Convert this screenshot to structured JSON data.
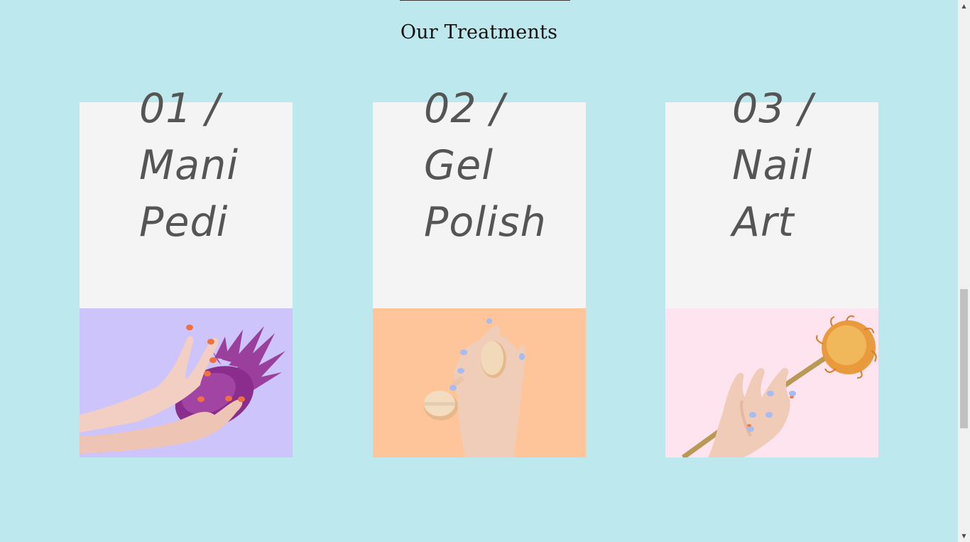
{
  "section": {
    "title": "Our Treatments"
  },
  "treatments": [
    {
      "number": "01 /",
      "line1": "Mani",
      "line2": "Pedi",
      "photo_bg": "#cdc4fb",
      "photo": "hand-with-pineapple-image"
    },
    {
      "number": "02 /",
      "line1": "Gel",
      "line2": "Polish",
      "photo_bg": "#ffc59a",
      "photo": "hand-with-macarons-image"
    },
    {
      "number": "03 /",
      "line1": "Nail",
      "line2": "Art",
      "photo_bg": "#fde4ee",
      "photo": "hand-with-flower-image"
    }
  ],
  "colors": {
    "page_bg": "#bde9ee",
    "card_bg": "#f4f4f4",
    "card_text": "#555555"
  }
}
